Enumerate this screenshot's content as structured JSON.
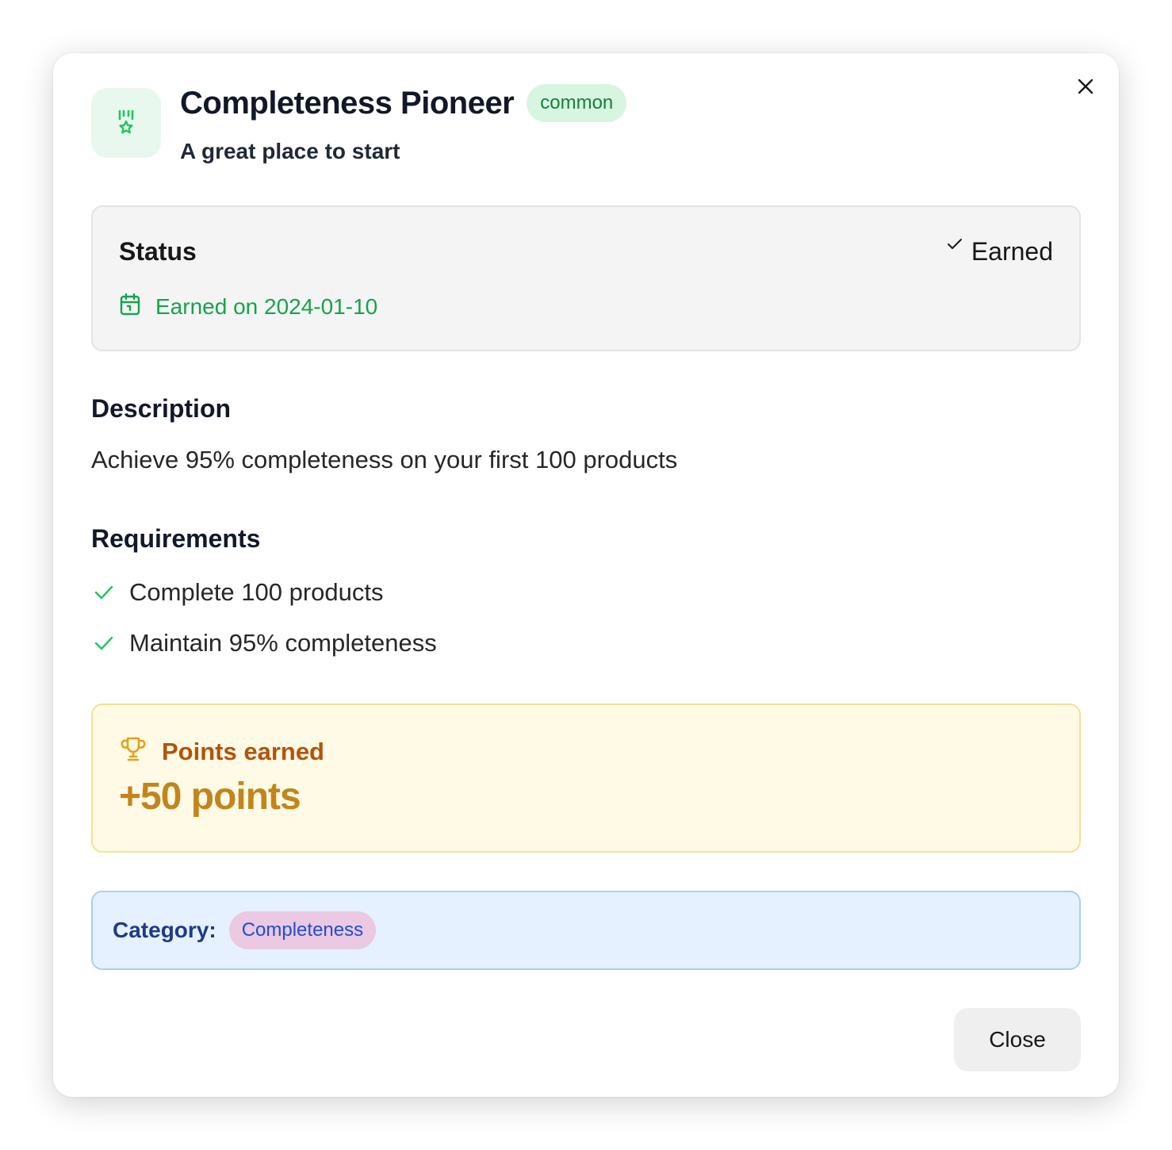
{
  "dialog": {
    "title": "Completeness Pioneer",
    "rarity": "common",
    "subtitle": "A great place to start",
    "badge_icon": "medal-icon",
    "close_icon": "close-icon"
  },
  "status": {
    "label": "Status",
    "value": "Earned",
    "value_icon": "check-icon",
    "earned_date": "Earned on 2024-01-10",
    "date_icon": "calendar-icon"
  },
  "description": {
    "heading": "Description",
    "text": "Achieve 95% completeness on your first 100 products"
  },
  "requirements": {
    "heading": "Requirements",
    "items": [
      {
        "label": "Complete 100 products",
        "done": true
      },
      {
        "label": "Maintain 95% completeness",
        "done": true
      }
    ]
  },
  "points": {
    "label": "Points earned",
    "value": "+50 points",
    "icon": "trophy-icon"
  },
  "category": {
    "label": "Category:",
    "value": "Completeness"
  },
  "footer": {
    "close_label": "Close"
  },
  "colors": {
    "success": "#16a34a",
    "points": "#c2851c",
    "category_text": "#1e3a8a"
  }
}
